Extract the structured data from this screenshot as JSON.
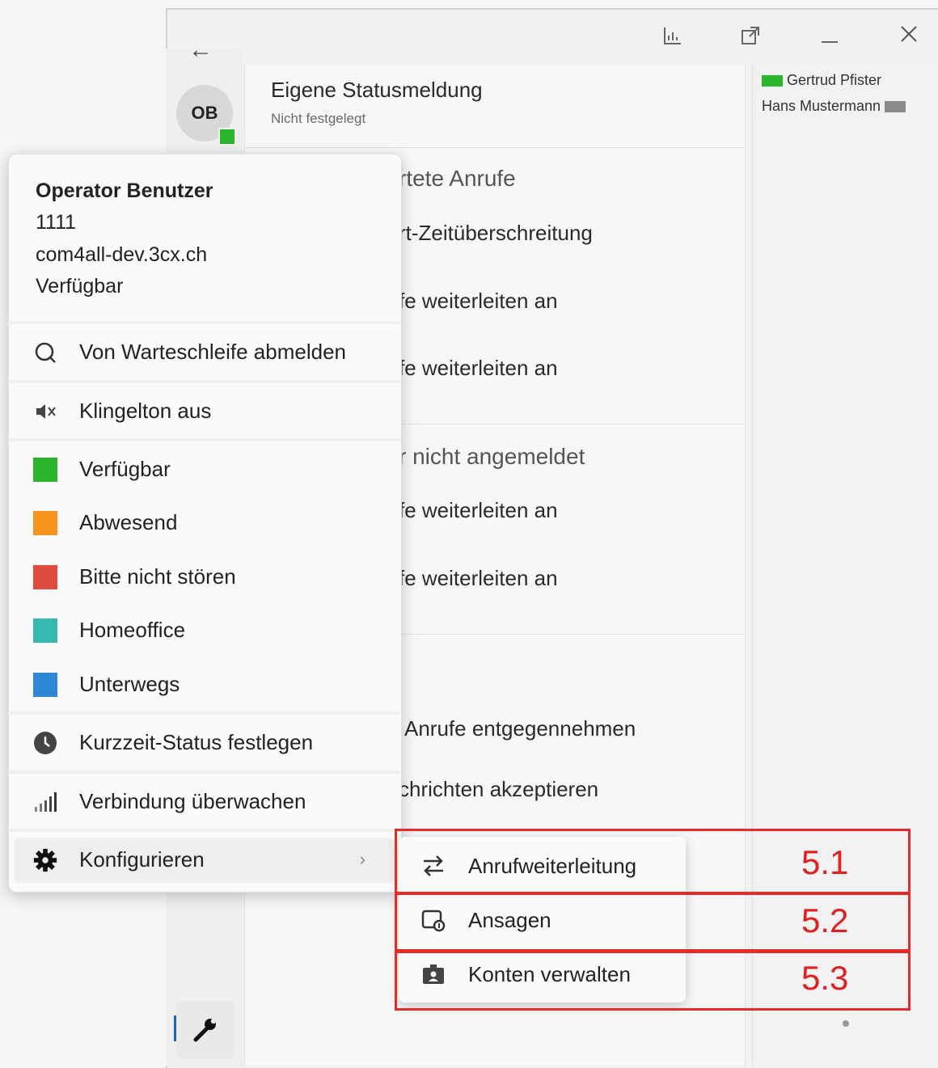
{
  "window": {
    "back_label": "←",
    "titlebar": [
      "chart-icon",
      "popout-icon",
      "minimize-icon",
      "close-icon"
    ]
  },
  "avatar": {
    "initials": "OB",
    "status_color": "#2bb52b"
  },
  "own_status": {
    "title": "Eigene Statusmeldung",
    "subtitle": "Nicht festgelegt"
  },
  "background_rows": [
    "rtete Anrufe",
    "rt-Zeitüberschreitung",
    "fe weiterleiten an",
    "fe weiterleiten an",
    "r nicht angemeldet",
    "fe weiterleiten an",
    "fe weiterleiten an",
    "Anrufe entgegennehmen",
    "chrichten akzeptieren"
  ],
  "contacts": [
    {
      "name": "Gertrud Pfister",
      "color": "#2bb52b"
    },
    {
      "name": "Hans Mustermann",
      "color": "#8a8a8a"
    }
  ],
  "user": {
    "name": "Operator Benutzer",
    "extension": "1111",
    "host": "com4all-dev.3cx.ch",
    "status": "Verfügbar"
  },
  "menu": {
    "queue_logout": "Von Warteschleife abmelden",
    "ringtone_off": "Klingelton aus",
    "statuses": [
      {
        "label": "Verfügbar",
        "color": "#2bb52b"
      },
      {
        "label": "Abwesend",
        "color": "#f7941d"
      },
      {
        "label": "Bitte nicht stören",
        "color": "#e04b3f"
      },
      {
        "label": "Homeoffice",
        "color": "#35b8b0"
      },
      {
        "label": "Unterwegs",
        "color": "#2e86d6"
      }
    ],
    "short_status": "Kurzzeit-Status festlegen",
    "monitor_connection": "Verbindung überwachen",
    "configure": "Konfigurieren",
    "configure_chevron": "›"
  },
  "submenu": {
    "items": [
      "Anrufweiterleitung",
      "Ansagen",
      "Konten verwalten"
    ]
  },
  "annotations": [
    "5.1",
    "5.2",
    "5.3"
  ],
  "colors": {
    "annotation": "#e52a2a",
    "accent": "#1e63c8"
  }
}
